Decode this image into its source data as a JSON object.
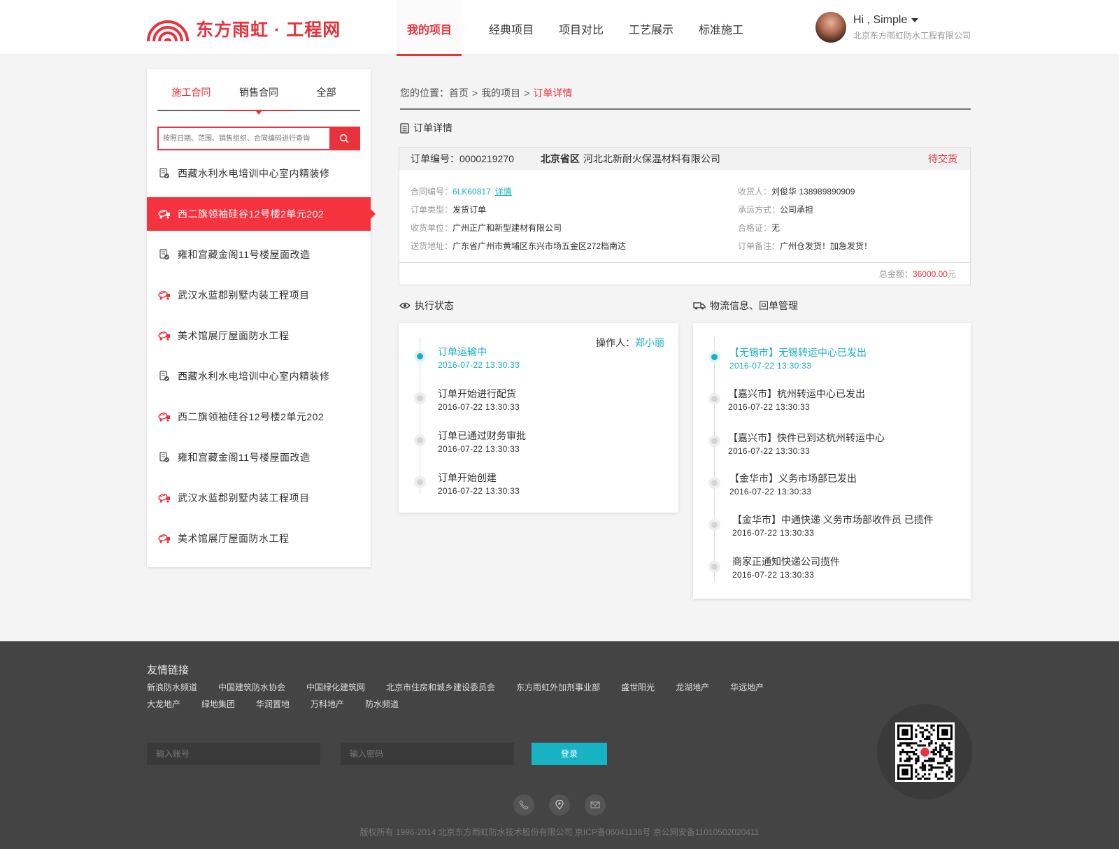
{
  "header": {
    "logo_text": "东方雨虹 · 工程网",
    "nav": [
      "我的项目",
      "经典项目",
      "项目对比",
      "工艺展示",
      "标准施工"
    ],
    "user_greeting": "Hi , Simple",
    "user_company": "北京东方雨虹防水工程有限公司"
  },
  "sidebar": {
    "tabs": [
      "施工合同",
      "销售合同",
      "全部"
    ],
    "search_placeholder": "按照日期、范围、销售组织、合同编码进行查询",
    "items": [
      {
        "label": "西藏水利水电培训中心室内精装修",
        "icon": "document-check-icon"
      },
      {
        "label": "西二旗领袖硅谷12号楼2单元202",
        "icon": "mixer-truck-icon"
      },
      {
        "label": "雍和宫藏金阁11号楼屋面改造",
        "icon": "document-check-icon"
      },
      {
        "label": "武汉水蓝郡别墅内装工程项目",
        "icon": "mixer-truck-icon"
      },
      {
        "label": "美术馆展厅屋面防水工程",
        "icon": "mixer-truck-icon"
      },
      {
        "label": "西藏水利水电培训中心室内精装修",
        "icon": "document-check-icon"
      },
      {
        "label": "西二旗领袖硅谷12号楼2单元202",
        "icon": "mixer-truck-icon"
      },
      {
        "label": "雍和宫藏金阁11号楼屋面改造",
        "icon": "document-check-icon"
      },
      {
        "label": "武汉水蓝郡别墅内装工程项目",
        "icon": "mixer-truck-icon"
      },
      {
        "label": "美术馆展厅屋面防水工程",
        "icon": "mixer-truck-icon"
      }
    ]
  },
  "breadcrumb": {
    "prefix": "您的位置：",
    "items": [
      "首页",
      "我的项目",
      "订单详情"
    ],
    "sep": ">"
  },
  "order": {
    "section_title": "订单详情",
    "number_label": "订单编号：",
    "number": "0000219270",
    "province": "北京省区",
    "company": "河北北新耐火保温材料有限公司",
    "status": "待交货",
    "contract_label": "合同编号：",
    "contract_no": "6LK60817",
    "detail_link": "详情",
    "type_label": "订单类型：",
    "type": "发货订单",
    "receiver_unit_label": "收货单位：",
    "receiver_unit": "广州正广和新型建材有限公司",
    "address_label": "送货地址：",
    "address": "广东省广州市黄埔区东兴市场五金区272档南达",
    "consignee_label": "收货人：",
    "consignee": "刘俊华 138989890909",
    "carrier_label": "承运方式：",
    "carrier": "公司承担",
    "cert_label": "合格证：",
    "cert": "无",
    "remark_label": "订单备注：",
    "remark": "广州仓发货！加急发货！",
    "total_label": "总金额：",
    "total_amount": "36000.00",
    "total_unit": "元"
  },
  "execution": {
    "title": "执行状态",
    "operator_label": "操作人：",
    "operator": "郑小丽",
    "steps": [
      {
        "label": "订单运输中",
        "time": "2016-07-22 13:30:33",
        "active": true
      },
      {
        "label": "订单开始进行配货",
        "time": "2016-07-22 13:30:33",
        "active": false
      },
      {
        "label": "订单已通过财务审批",
        "time": "2016-07-22 13:30:33",
        "active": false
      },
      {
        "label": "订单开始创建",
        "time": "2016-07-22 13:30:33",
        "active": false
      }
    ]
  },
  "logistics": {
    "title": "物流信息、回单管理",
    "steps": [
      {
        "label": "【无锡市】无锡转运中心已发出",
        "time": "2016-07-22 13:30:33",
        "active": true
      },
      {
        "label": "【嘉兴市】杭州转运中心已发出",
        "time": "2016-07-22 13:30:33",
        "active": false
      },
      {
        "label": "【嘉兴市】快件已到达杭州转运中心",
        "time": "2016-07-22 13:30:33",
        "active": false
      },
      {
        "label": "【金华市】义务市场部已发出",
        "time": "2016-07-22 13:30:33",
        "active": false
      },
      {
        "label": "【金华市】中通快递 义务市场部收件员 已揽件",
        "time": "2016-07-22 13:30:33",
        "active": false
      },
      {
        "label": "商家正通知快递公司揽件",
        "time": "2016-07-22 13:30:33",
        "active": false
      }
    ]
  },
  "footer": {
    "links_title": "友情链接",
    "links_row1": [
      "新浪防水频道",
      "中国建筑防水协会",
      "中国绿化建筑网",
      "北京市住房和城乡建设委员会",
      "东方雨虹外加剂事业部",
      "盛世阳光",
      "龙湖地产",
      "华远地产"
    ],
    "links_row2": [
      "大龙地产",
      "绿地集团",
      "华润置地",
      "万科地产",
      "防水频道"
    ],
    "account_placeholder": "输入账号",
    "password_placeholder": "输入密码",
    "login_button": "登录",
    "copyright": "版权所有 1996-2014 北京东方雨虹防水技术股份有限公司   京ICP备06041138号   京公网安备11010502020411"
  },
  "colors": {
    "brand": "#e8323c",
    "accent": "#1ab0c2",
    "footer_bg": "#444444"
  }
}
